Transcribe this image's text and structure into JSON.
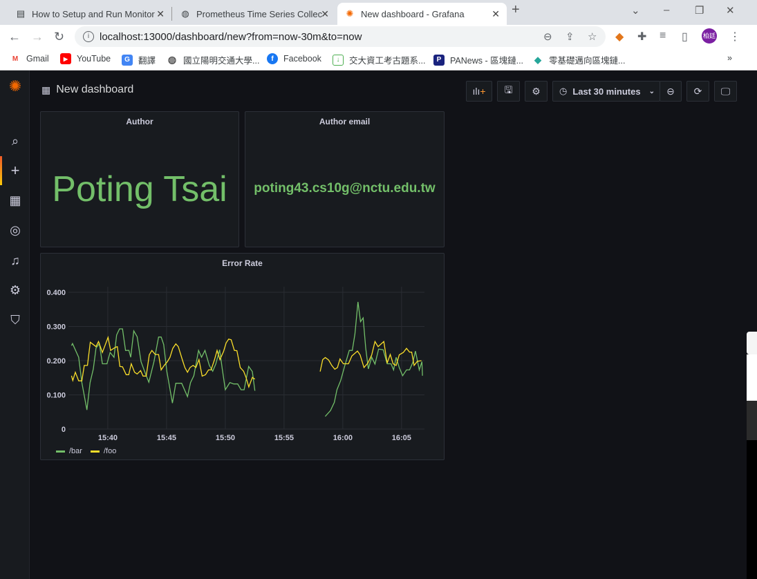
{
  "browser": {
    "tabs": [
      {
        "title": "How to Setup and Run Monitor",
        "icon": "document-icon"
      },
      {
        "title": "Prometheus Time Series Collec",
        "icon": "globe-icon"
      },
      {
        "title": "New dashboard - Grafana",
        "icon": "grafana-icon",
        "active": true
      }
    ],
    "url": "localhost:13000/dashboard/new?from=now-30m&to=now",
    "profile_initials": "柏廷",
    "bookmarks": [
      {
        "label": "Gmail",
        "color": "#ea4335",
        "glyph": "M"
      },
      {
        "label": "YouTube",
        "color": "#ff0000",
        "glyph": "▶"
      },
      {
        "label": "翻譯",
        "color": "#4285f4",
        "glyph": "G"
      },
      {
        "label": "國立陽明交通大學...",
        "color": "#555555",
        "glyph": "◍"
      },
      {
        "label": "Facebook",
        "color": "#1877f2",
        "glyph": "f"
      },
      {
        "label": "交大資工考古題系...",
        "color": "#4caf50",
        "glyph": "↓"
      },
      {
        "label": "PANews - 區塊鏈...",
        "color": "#1a237e",
        "glyph": "P"
      },
      {
        "label": "零基礎邁向區塊鏈...",
        "color": "#26a69a",
        "glyph": "◆"
      }
    ],
    "more_bookmarks": "»"
  },
  "grafana": {
    "dashboard_title": "New dashboard",
    "time_range": "Last 30 minutes",
    "sidebar": [
      "search-icon",
      "plus-icon",
      "dashboards-icon",
      "explore-icon",
      "alerting-icon",
      "configuration-icon",
      "shield-icon"
    ],
    "panels": {
      "author": {
        "title": "Author",
        "value": "Poting Tsai"
      },
      "email": {
        "title": "Author email",
        "value": "poting43.cs10g@nctu.edu.tw"
      }
    },
    "colors": {
      "bar": "#73bf69",
      "foo": "#fade2a"
    }
  },
  "chart_data": {
    "type": "line",
    "title": "Error Rate",
    "x_unit": "minutes past 15:00",
    "xlim": [
      36.65,
      66.95
    ],
    "ylim": [
      0,
      0.4
    ],
    "yticks": [
      {
        "v": 0,
        "label": "0"
      },
      {
        "v": 0.1,
        "label": "0.100"
      },
      {
        "v": 0.2,
        "label": "0.200"
      },
      {
        "v": 0.3,
        "label": "0.300"
      },
      {
        "v": 0.4,
        "label": "0.400"
      }
    ],
    "xticks": [
      {
        "v": 40,
        "label": "15:40"
      },
      {
        "v": 45,
        "label": "15:45"
      },
      {
        "v": 50,
        "label": "15:50"
      },
      {
        "v": 55,
        "label": "15:55"
      },
      {
        "v": 60,
        "label": "16:00"
      },
      {
        "v": 65,
        "label": "16:05"
      }
    ],
    "legend_position": "bottom-left",
    "grid": true,
    "series": [
      {
        "name": "/bar",
        "color": "#73bf69",
        "segments": [
          [
            [
              36.91,
              0.244
            ],
            [
              37.0,
              0.25
            ],
            [
              37.52,
              0.21
            ],
            [
              37.79,
              0.136
            ],
            [
              38.22,
              0.056
            ],
            [
              38.49,
              0.136
            ],
            [
              38.77,
              0.176
            ],
            [
              39.0,
              0.237
            ],
            [
              39.28,
              0.25
            ],
            [
              39.54,
              0.191
            ],
            [
              39.93,
              0.191
            ],
            [
              40.2,
              0.224
            ],
            [
              40.53,
              0.21
            ],
            [
              40.75,
              0.275
            ],
            [
              41.0,
              0.293
            ],
            [
              41.25,
              0.293
            ],
            [
              41.51,
              0.23
            ],
            [
              41.8,
              0.23
            ],
            [
              41.95,
              0.21
            ],
            [
              42.21,
              0.287
            ],
            [
              42.5,
              0.27
            ],
            [
              42.83,
              0.197
            ],
            [
              43.27,
              0.156
            ],
            [
              43.49,
              0.137
            ],
            [
              43.93,
              0.197
            ],
            [
              44.32,
              0.269
            ],
            [
              44.54,
              0.269
            ],
            [
              44.76,
              0.247
            ],
            [
              45.02,
              0.169
            ],
            [
              45.5,
              0.076
            ],
            [
              45.79,
              0.134
            ],
            [
              46.29,
              0.134
            ],
            [
              46.78,
              0.095
            ],
            [
              47.04,
              0.136
            ],
            [
              47.32,
              0.156
            ],
            [
              47.72,
              0.23
            ],
            [
              47.98,
              0.21
            ],
            [
              48.27,
              0.23
            ],
            [
              48.64,
              0.186
            ],
            [
              48.93,
              0.169
            ],
            [
              49.19,
              0.19
            ],
            [
              49.52,
              0.232
            ],
            [
              49.74,
              0.176
            ],
            [
              50.0,
              0.115
            ],
            [
              50.39,
              0.136
            ],
            [
              50.72,
              0.132
            ],
            [
              51.05,
              0.132
            ],
            [
              51.34,
              0.115
            ],
            [
              51.6,
              0.115
            ],
            [
              51.99,
              0.183
            ],
            [
              52.3,
              0.168
            ],
            [
              52.52,
              0.112
            ]
          ],
          [
            [
              58.5,
              0.037
            ],
            [
              58.95,
              0.054
            ],
            [
              59.28,
              0.078
            ],
            [
              59.5,
              0.115
            ],
            [
              59.82,
              0.142
            ],
            [
              60.15,
              0.183
            ],
            [
              60.55,
              0.23
            ],
            [
              60.81,
              0.23
            ],
            [
              61.03,
              0.278
            ],
            [
              61.29,
              0.372
            ],
            [
              61.51,
              0.314
            ],
            [
              61.73,
              0.325
            ],
            [
              61.95,
              0.237
            ],
            [
              62.17,
              0.176
            ],
            [
              62.46,
              0.21
            ],
            [
              62.74,
              0.19
            ],
            [
              63.05,
              0.234
            ],
            [
              63.44,
              0.232
            ],
            [
              63.77,
              0.191
            ],
            [
              64.1,
              0.191
            ],
            [
              64.32,
              0.173
            ],
            [
              64.54,
              0.21
            ],
            [
              64.8,
              0.18
            ],
            [
              65.09,
              0.156
            ],
            [
              65.42,
              0.173
            ],
            [
              65.68,
              0.173
            ],
            [
              65.96,
              0.195
            ],
            [
              66.18,
              0.228
            ],
            [
              66.51,
              0.173
            ],
            [
              66.73,
              0.197
            ],
            [
              66.78,
              0.156
            ]
          ]
        ]
      },
      {
        "name": "/foo",
        "color": "#fade2a",
        "segments": [
          [
            [
              36.91,
              0.156
            ],
            [
              37.02,
              0.142
            ],
            [
              37.24,
              0.166
            ],
            [
              37.52,
              0.141
            ],
            [
              37.79,
              0.141
            ],
            [
              38.0,
              0.186
            ],
            [
              38.27,
              0.186
            ],
            [
              38.51,
              0.254
            ],
            [
              39.0,
              0.241
            ],
            [
              39.21,
              0.256
            ],
            [
              39.54,
              0.224
            ],
            [
              40.02,
              0.268
            ],
            [
              40.24,
              0.23
            ],
            [
              40.64,
              0.239
            ],
            [
              40.81,
              0.241
            ],
            [
              41.03,
              0.183
            ],
            [
              41.25,
              0.182
            ],
            [
              41.56,
              0.159
            ],
            [
              41.78,
              0.159
            ],
            [
              42.0,
              0.191
            ],
            [
              42.28,
              0.166
            ],
            [
              42.5,
              0.161
            ],
            [
              42.79,
              0.171
            ],
            [
              43.0,
              0.155
            ],
            [
              43.27,
              0.155
            ],
            [
              43.53,
              0.217
            ],
            [
              43.75,
              0.23
            ],
            [
              44.04,
              0.218
            ],
            [
              44.32,
              0.218
            ],
            [
              44.54,
              0.173
            ],
            [
              44.8,
              0.186
            ],
            [
              45.07,
              0.197
            ],
            [
              45.29,
              0.21
            ],
            [
              45.53,
              0.236
            ],
            [
              45.79,
              0.249
            ],
            [
              46.0,
              0.241
            ],
            [
              46.34,
              0.203
            ],
            [
              46.56,
              0.18
            ],
            [
              46.78,
              0.166
            ],
            [
              47.0,
              0.18
            ],
            [
              47.26,
              0.186
            ],
            [
              47.5,
              0.18
            ],
            [
              47.76,
              0.203
            ],
            [
              48.03,
              0.155
            ],
            [
              48.31,
              0.159
            ],
            [
              48.57,
              0.173
            ],
            [
              48.79,
              0.173
            ],
            [
              49.08,
              0.203
            ],
            [
              49.3,
              0.23
            ],
            [
              49.54,
              0.203
            ],
            [
              49.85,
              0.227
            ],
            [
              50.07,
              0.252
            ],
            [
              50.29,
              0.263
            ],
            [
              50.5,
              0.261
            ],
            [
              50.77,
              0.23
            ],
            [
              50.99,
              0.229
            ],
            [
              51.27,
              0.18
            ],
            [
              51.56,
              0.169
            ],
            [
              51.78,
              0.149
            ],
            [
              52.0,
              0.123
            ],
            [
              52.3,
              0.151
            ],
            [
              52.52,
              0.146
            ]
          ],
          [
            [
              58.07,
              0.168
            ],
            [
              58.29,
              0.203
            ],
            [
              58.51,
              0.209
            ],
            [
              58.79,
              0.202
            ],
            [
              59.06,
              0.186
            ],
            [
              59.32,
              0.175
            ],
            [
              59.54,
              0.18
            ],
            [
              59.76,
              0.205
            ],
            [
              60.04,
              0.191
            ],
            [
              60.48,
              0.191
            ],
            [
              60.77,
              0.214
            ],
            [
              61.25,
              0.228
            ],
            [
              61.47,
              0.217
            ],
            [
              61.8,
              0.18
            ],
            [
              62.13,
              0.193
            ],
            [
              62.46,
              0.217
            ],
            [
              62.74,
              0.256
            ],
            [
              63.0,
              0.241
            ],
            [
              63.49,
              0.256
            ],
            [
              63.77,
              0.193
            ],
            [
              64.04,
              0.218
            ],
            [
              64.28,
              0.191
            ],
            [
              64.54,
              0.186
            ],
            [
              64.8,
              0.217
            ],
            [
              65.15,
              0.224
            ],
            [
              65.42,
              0.236
            ],
            [
              65.68,
              0.225
            ],
            [
              65.86,
              0.225
            ],
            [
              66.07,
              0.186
            ],
            [
              66.34,
              0.198
            ],
            [
              66.69,
              0.2
            ]
          ]
        ]
      }
    ]
  }
}
